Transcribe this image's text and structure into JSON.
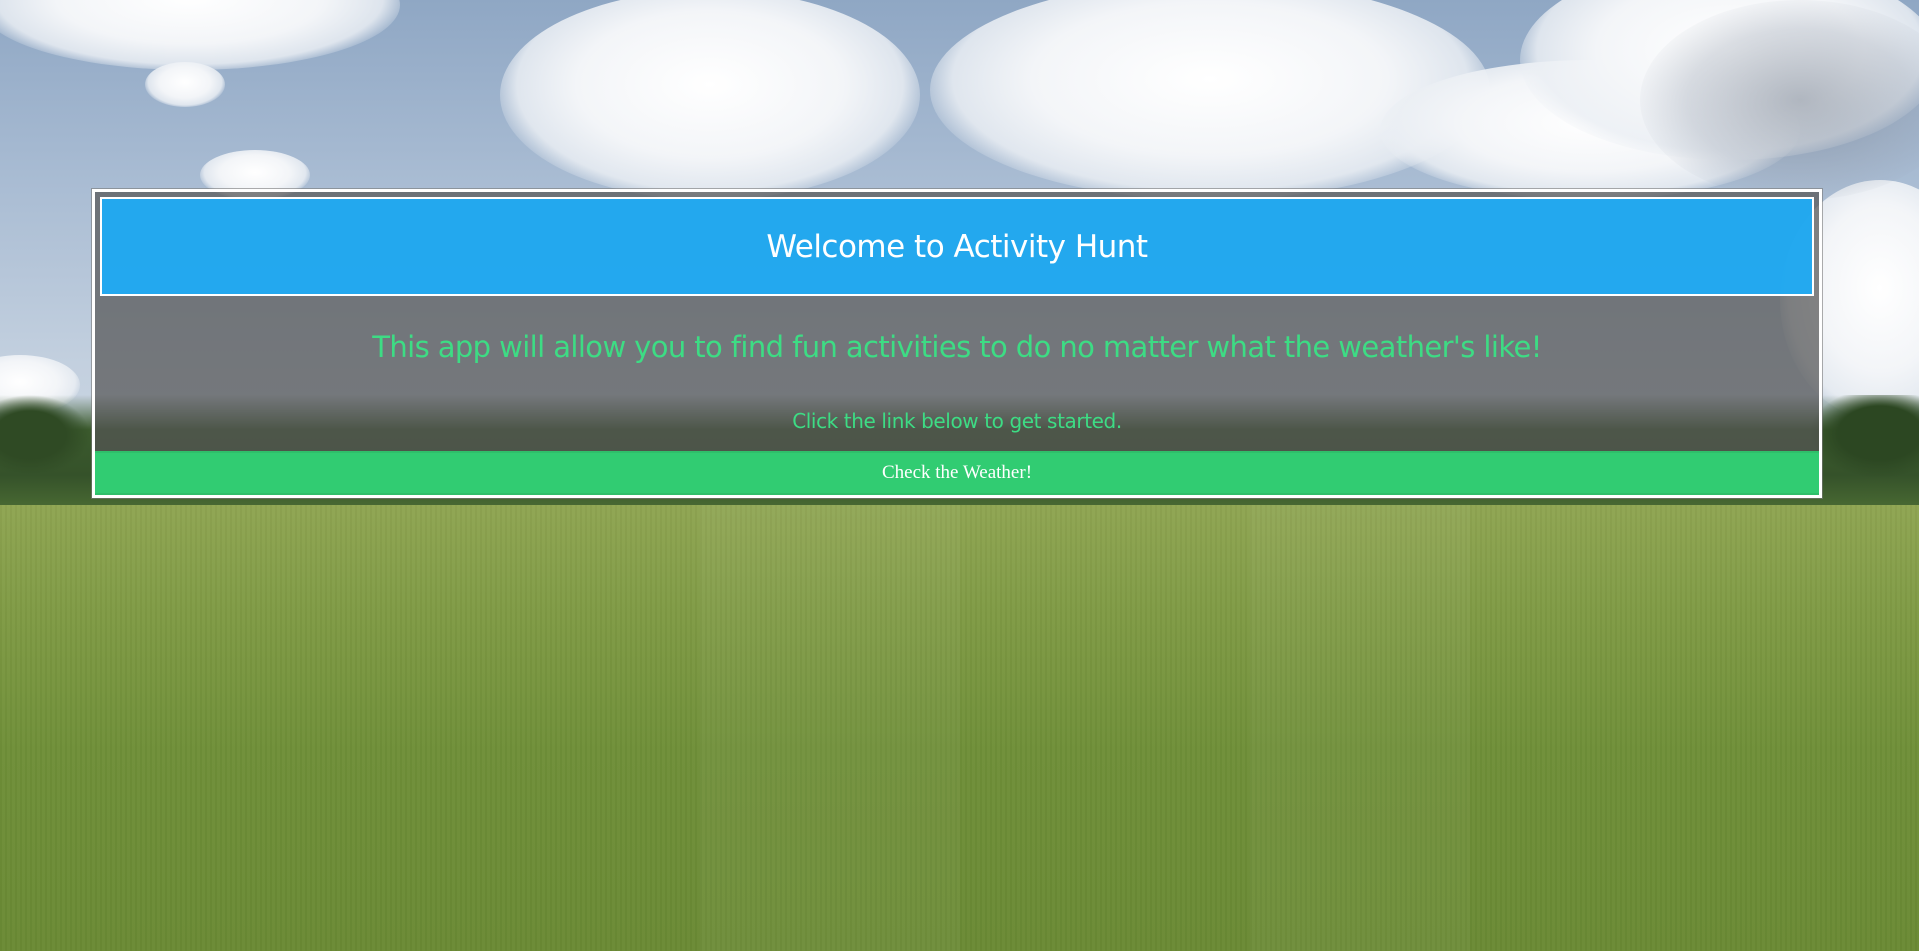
{
  "header": {
    "title": "Welcome to Activity Hunt"
  },
  "intro": {
    "tagline": "This app will allow you to find fun activities to do no matter what the weather's like!",
    "instruction": "Click the link below to get started."
  },
  "cta": {
    "label": "Check the Weather!"
  },
  "colors": {
    "header_bg": "#1DACF7",
    "text_accent": "#3DDC84",
    "cta_bg": "#2EDD78",
    "panel_bg": "#555555",
    "border": "#FFFFFF"
  }
}
